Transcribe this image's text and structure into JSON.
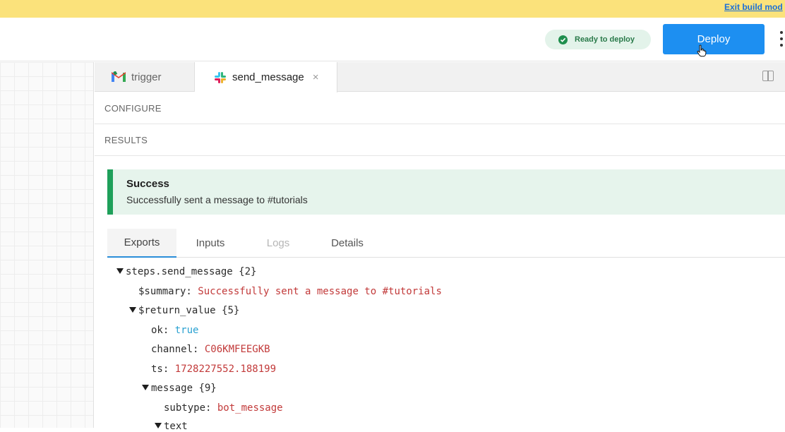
{
  "banner": {
    "exit_link": "Exit build mod"
  },
  "header": {
    "status_label": "Ready to deploy",
    "deploy_label": "Deploy"
  },
  "tabs": [
    {
      "label": "trigger",
      "icon": "gmail-icon"
    },
    {
      "label": "send_message",
      "icon": "slack-icon",
      "close": "×"
    }
  ],
  "sections": {
    "configure": "CONFIGURE",
    "results": "RESULTS"
  },
  "alert": {
    "title": "Success",
    "message": "Successfully sent a message to #tutorials"
  },
  "result_tabs": [
    "Exports",
    "Inputs",
    "Logs",
    "Details"
  ],
  "tree": {
    "root_key": "steps.send_message",
    "root_count": "{2}",
    "summary_key": "$summary:",
    "summary_value": "Successfully sent a message to #tutorials",
    "return_key": "$return_value",
    "return_count": "{5}",
    "ok_key": "ok:",
    "ok_value": "true",
    "channel_key": "channel:",
    "channel_value": "C06KMFEEGKB",
    "ts_key": "ts:",
    "ts_value": "1728227552.188199",
    "message_key": "message",
    "message_count": "{9}",
    "subtype_key": "subtype:",
    "subtype_value": "bot_message",
    "text_key": "text"
  },
  "colors": {
    "accent": "#1d8ff1",
    "success": "#1ea05a",
    "banner": "#fbe27b",
    "string": "#c23a3a",
    "boolean": "#2aa1d1"
  }
}
